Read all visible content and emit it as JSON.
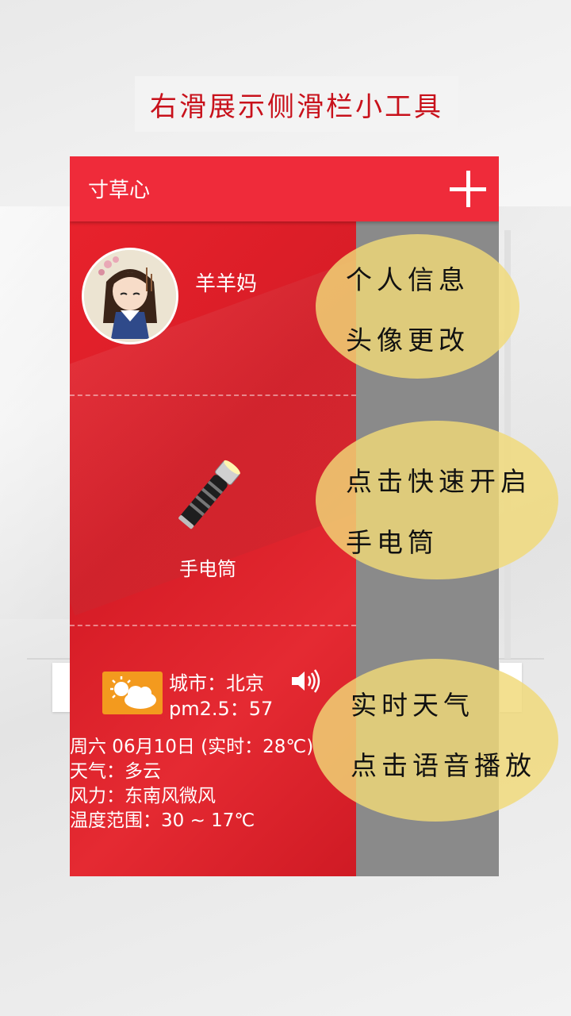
{
  "page_title": "右滑展示侧滑栏小工具",
  "app": {
    "title": "寸草心",
    "add_icon": "plus-icon",
    "accent_color": "#ef2b3a",
    "drawer_color": "#e0232d"
  },
  "profile": {
    "name": "羊羊妈",
    "avatar_icon": "avatar-girl"
  },
  "flashlight": {
    "label": "手电筒",
    "icon": "flashlight-icon"
  },
  "weather": {
    "icon": "partly-cloudy-icon",
    "city": "城市：北京",
    "pm": "pm2.5：57",
    "date": "周六 06月10日 (实时：28℃)",
    "condition": "天气：多云",
    "wind": "风力：东南风微风",
    "temp_range": "温度范围：30 ~ 17℃",
    "speaker_icon": "speaker-icon"
  },
  "callouts": [
    {
      "line1": "个人信息",
      "line2": "头像更改"
    },
    {
      "line1": "点击快速开启",
      "line2": "手电筒"
    },
    {
      "line1": "实时天气",
      "line2": "点击语音播放"
    }
  ]
}
